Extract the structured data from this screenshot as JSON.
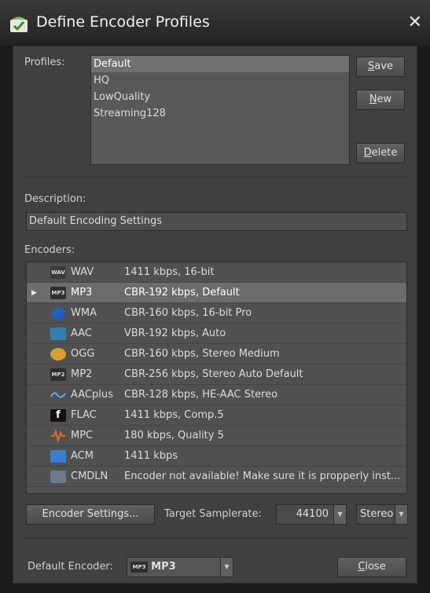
{
  "window": {
    "title": "Define Encoder Profiles",
    "close_glyph": "✕"
  },
  "profiles": {
    "label": "Profiles:",
    "items": [
      "Default",
      "HQ",
      "LowQuality",
      "Streaming128"
    ],
    "selected": "Default"
  },
  "buttons": {
    "save_first": "S",
    "save_rest": "ave",
    "new_first": "N",
    "new_rest": "ew",
    "delete_first": "D",
    "delete_rest": "elete",
    "encoder_settings": "Encoder Settings...",
    "close_first": "C",
    "close_rest": "lose"
  },
  "description": {
    "label": "Description:",
    "value": "Default Encoding Settings"
  },
  "encoders": {
    "label": "Encoders:",
    "rows": [
      {
        "icon": "wav-icon",
        "icon_text": "WAV",
        "name": "WAV",
        "detail": "1411 kbps, 16-bit",
        "selected": false
      },
      {
        "icon": "mp3-icon",
        "icon_text": "MP3",
        "name": "MP3",
        "detail": "CBR-192 kbps, Default",
        "selected": true
      },
      {
        "icon": "wma-icon",
        "icon_text": "",
        "name": "WMA",
        "detail": "CBR-160 kbps, 16-bit Pro",
        "selected": false
      },
      {
        "icon": "aac-icon",
        "icon_text": "",
        "name": "AAC",
        "detail": "VBR-192 kbps, Auto",
        "selected": false
      },
      {
        "icon": "ogg-icon",
        "icon_text": "",
        "name": "OGG",
        "detail": "CBR-160 kbps, Stereo Medium",
        "selected": false
      },
      {
        "icon": "mp2-icon",
        "icon_text": "MP2",
        "name": "MP2",
        "detail": "CBR-256 kbps, Stereo Auto Default",
        "selected": false
      },
      {
        "icon": "aacplus-icon",
        "icon_text": "",
        "name": "AACplus",
        "detail": "CBR-128 kbps, HE-AAC Stereo",
        "selected": false
      },
      {
        "icon": "flac-icon",
        "icon_text": "f",
        "name": "FLAC",
        "detail": "1411 kbps, Comp.5",
        "selected": false
      },
      {
        "icon": "mpc-icon",
        "icon_text": "",
        "name": "MPC",
        "detail": "180 kbps, Quality 5",
        "selected": false
      },
      {
        "icon": "acm-icon",
        "icon_text": "",
        "name": "ACM",
        "detail": "1411 kbps",
        "selected": false
      },
      {
        "icon": "cmdln-icon",
        "icon_text": "",
        "name": "CMDLN",
        "detail": "Encoder not available! Make sure it is propperly inst...",
        "selected": false
      }
    ]
  },
  "samplerate": {
    "label": "Target Samplerate:",
    "value": "44100",
    "channels": "Stereo"
  },
  "default_encoder": {
    "label": "Default Encoder:",
    "icon_text": "MP3",
    "value": "MP3"
  },
  "colors": {
    "panel": "#404040",
    "selection": "#707070",
    "accent_green": "#5ba33a"
  }
}
